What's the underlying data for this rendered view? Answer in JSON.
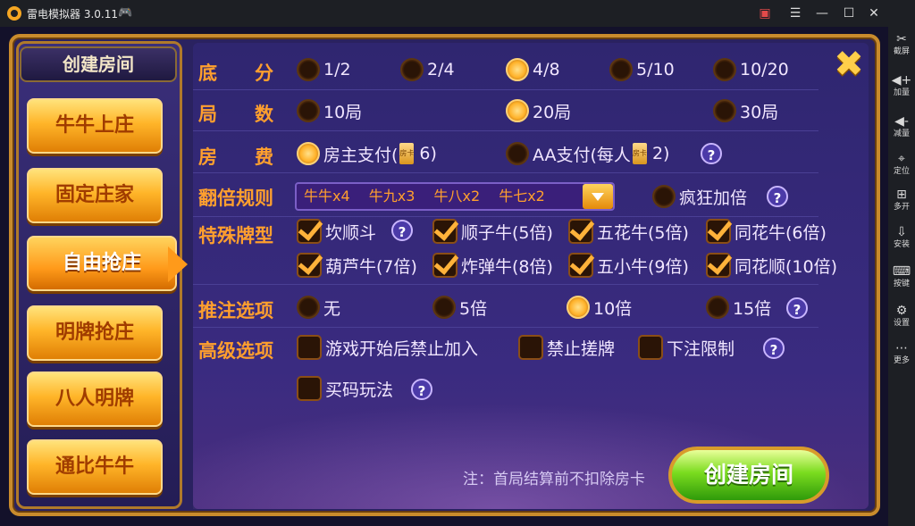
{
  "window": {
    "title": "雷电模拟器 3.0.11"
  },
  "sidebar": [
    {
      "icon": "scissors-icon",
      "glyph": "✂",
      "label": "截屏"
    },
    {
      "icon": "volume-up-icon",
      "glyph": "◀+",
      "label": "加量"
    },
    {
      "icon": "volume-down-icon",
      "glyph": "◀-",
      "label": "减量"
    },
    {
      "icon": "location-icon",
      "glyph": "⌖",
      "label": "定位"
    },
    {
      "icon": "multi-open-icon",
      "glyph": "⊞",
      "label": "多开"
    },
    {
      "icon": "install-icon",
      "glyph": "⇩",
      "label": "安装"
    },
    {
      "icon": "keyboard-icon",
      "glyph": "⌨",
      "label": "按键"
    },
    {
      "icon": "settings-icon",
      "glyph": "⚙",
      "label": "设置"
    },
    {
      "icon": "more-icon",
      "glyph": "⋯",
      "label": "更多"
    }
  ],
  "menu": {
    "title": "创建房间",
    "items": [
      "牛牛上庄",
      "固定庄家",
      "自由抢庄",
      "明牌抢庄",
      "八人明牌",
      "通比牛牛"
    ],
    "active_index": 2
  },
  "rows": {
    "base_score": {
      "label": "底　　分",
      "options": [
        "1/2",
        "2/4",
        "4/8",
        "5/10",
        "10/20"
      ],
      "selected": "4/8"
    },
    "rounds": {
      "label": "局　　数",
      "options": [
        "10局",
        "20局",
        "30局"
      ],
      "selected": "20局"
    },
    "fee": {
      "label": "房　　费",
      "owner_pay": "房主支付(",
      "owner_cost": "6)",
      "aa_pay": "AA支付(每人",
      "aa_cost": "2)",
      "selected": "房主支付"
    },
    "double_rule": {
      "label": "翻倍规则",
      "value": "牛牛x4　 牛九x3　 牛八x2　 牛七x2",
      "crazy": "疯狂加倍",
      "crazy_on": false
    },
    "special": {
      "label": "特殊牌型",
      "options": [
        "坎顺斗",
        "顺子牛(5倍)",
        "五花牛(5倍)",
        "同花牛(6倍)",
        "葫芦牛(7倍)",
        "炸弹牛(8倍)",
        "五小牛(9倍)",
        "同花顺(10倍)"
      ]
    },
    "push": {
      "label": "推注选项",
      "options": [
        "无",
        "5倍",
        "10倍",
        "15倍"
      ],
      "selected": "10倍"
    },
    "advanced": {
      "label": "高级选项",
      "options": [
        "游戏开始后禁止加入",
        "禁止搓牌",
        "下注限制",
        "买码玩法"
      ]
    }
  },
  "note": "注：首局结算前不扣除房卡",
  "create_button": "创建房间",
  "close_glyph": "✖",
  "help_glyph": "?"
}
